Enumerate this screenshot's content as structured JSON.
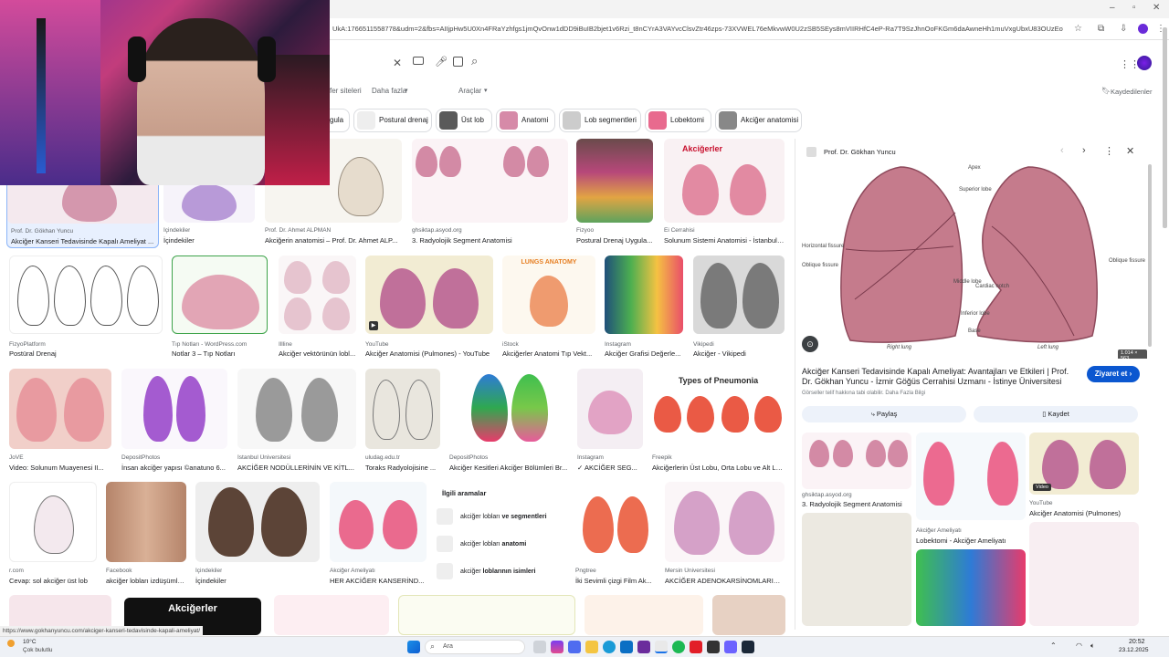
{
  "browser": {
    "url": "UkA:1766511558778&udm=2&fbs=AIIjpHw5U0Xn4FRaYzhfgs1jmQvOnw1dDD9iBuIB2bjet1v6Rzi_t8nCYrA3VAYvcClsvZtr46zps-73XVWEL76eMkvwW0U2zSB5SEys8mVIIRHfC4eP-Ra7T9SzJhnOoFKGm6daAwneHh1muVxgUbxU83OUzEoVqUc_HFVoav_yweibHtu4..."
  },
  "search": {
    "tabs": [
      "fer siteleri",
      "Daha fazla",
      "Araçlar"
    ],
    "saved_label": "Kaydedilenler"
  },
  "chips": [
    "gula",
    "Postural drenaj",
    "Üst lob",
    "Anatomi",
    "Lob segmentleri",
    "Lobektomi",
    "Akciğer anatomisi"
  ],
  "results": {
    "row1": [
      {
        "source": "Prof. Dr. Gökhan Yuncu",
        "title": "Akciğer Kanseri Tedavisinde Kapalı Ameliyat ..."
      },
      {
        "source": "İçindekiler",
        "title": "İçindekiler"
      },
      {
        "source": "Prof. Dr. Ahmet ALPMAN",
        "title": "Akciğerin anatomisi – Prof. Dr. Ahmet ALP..."
      },
      {
        "source": "ghsiktap.asyod.org",
        "title": "3. Radyolojik Segment Anatomisi"
      },
      {
        "source": "Fizyoo",
        "title": "Postural Drenaj Uygula..."
      },
      {
        "source": "Ei Cerrahisi",
        "title": "Solunum Sistemi Anatomisi - İstanbul ..."
      }
    ],
    "row2": [
      {
        "source": "FizyoPlatform",
        "title": "Postüral Drenaj"
      },
      {
        "source": "Tıp Notları - WordPress.com",
        "title": "Notlar 3 – Tıp Notları"
      },
      {
        "source": "Illline",
        "title": "Akciğer vektörünün lobl..."
      },
      {
        "source": "YouTube",
        "title": "Akciğer Anatomisi (Pulmones) - YouTube"
      },
      {
        "source": "iStock",
        "title": "Akciğerler Anatomi Tıp Vekt..."
      },
      {
        "source": "Instagram",
        "title": "Akciğer Grafisi Değerle..."
      },
      {
        "source": "Vikipedi",
        "title": "Akciğer - Vikipedi"
      }
    ],
    "row3": [
      {
        "source": "JoVE",
        "title": "Video: Solunum Muayenesi II..."
      },
      {
        "source": "DepositPhotos",
        "title": "İnsan akciğer yapısı ©anatuno 6..."
      },
      {
        "source": "İstanbul Üniversitesi",
        "title": "AKCİĞER NODÜLLERİNİN VE KİTL..."
      },
      {
        "source": "uludag.edu.tr",
        "title": "Toraks Radyolojisine ..."
      },
      {
        "source": "DepositPhotos",
        "title": "Akciğer Kesitleri Akciğer Bölümleri Br..."
      },
      {
        "source": "Instagram",
        "title": "✓ AKCİĞER SEG..."
      },
      {
        "source": "Freepik",
        "title": "Akciğerlerin Üst Lobu, Orta Lobu ve Alt Lo..."
      }
    ],
    "row4": [
      {
        "source": "r.com",
        "title": "Cevap: sol akciğer üst lob"
      },
      {
        "source": "Facebook",
        "title": "akciğer lobları izdüşümle..."
      },
      {
        "source": "İçindekiler",
        "title": "İçindekiler"
      },
      {
        "source": "Akciğer Ameliyatı",
        "title": "HER AKCİĞER KANSERİND..."
      },
      {
        "source": "Pngtree",
        "title": "İki Sevimli çizgi Film Ak..."
      },
      {
        "source": "Mersin Üniversitesi",
        "title": "AKCİĞER ADENOKARSİNOMLARINI..."
      }
    ],
    "overlay_texts": {
      "akcigerler": "Akciğerler",
      "lungs_anatomy": "LUNGS ANATOMY",
      "types_pneumonia": "Types of Pneumonia",
      "akcigerler_dark": "Akciğerler"
    }
  },
  "related": {
    "heading": "İlgili aramalar",
    "items": [
      {
        "prefix": "akciğer lobları ",
        "bold": "ve segmentleri"
      },
      {
        "prefix": "akciğer lobları ",
        "bold": "anatomi"
      },
      {
        "prefix": "akciğer ",
        "bold": "loblarının isimleri"
      }
    ]
  },
  "panel": {
    "source": "Prof. Dr. Gökhan Yuncu",
    "title": "Akciğer Kanseri Tedavisinde Kapalı Ameliyat: Avantajları ve Etkileri | Prof. Dr. Gökhan Yuncu - İzmir Göğüs Cerrahisi Uzmanı - İstinye Üniversitesi",
    "visit_label": "Ziyaret et",
    "copyright": "Görseller telif hakkına tabi olabilir. Daha Fazla Bilgi",
    "share_label": "Paylaş",
    "save_label": "Kaydet",
    "image_size": "1.014 × 563",
    "labels": {
      "apex": "Apex",
      "superior_lobe": "Superior lobe",
      "horizontal_fissure": "Horizontal fissure",
      "oblique_fissure_l": "Oblique fissure",
      "oblique_fissure_r": "Oblique fissure",
      "middle_lobe": "Middle lobe",
      "cardiac_notch": "Cardiac notch",
      "inferior_lobe": "Inferior lobe",
      "base": "Base",
      "right_lung": "Right lung",
      "left_lung": "Left lung"
    },
    "related_cards": [
      {
        "source": "ghsiktap.asyod.org",
        "title": "3. Radyolojik Segment Anatomisi"
      },
      {
        "source": "Akciğer Ameliyatı",
        "title": "Lobektomi - Akciğer Ameliyatı"
      },
      {
        "source": "YouTube",
        "title": "Akciğer Anatomisi (Pulmones)",
        "badge": "Video"
      }
    ]
  },
  "status_url": "https://www.gokhanyuncu.com/akciger-kanseri-tedavisinde-kapali-ameliyat/",
  "taskbar": {
    "weather_temp": "10°C",
    "weather_desc": "Çok bulutlu",
    "search_placeholder": "Ara",
    "time": "20:52",
    "date": "23.12.2025"
  },
  "colors": {
    "accent": "#1a73e8",
    "lung": "#c06a86"
  }
}
